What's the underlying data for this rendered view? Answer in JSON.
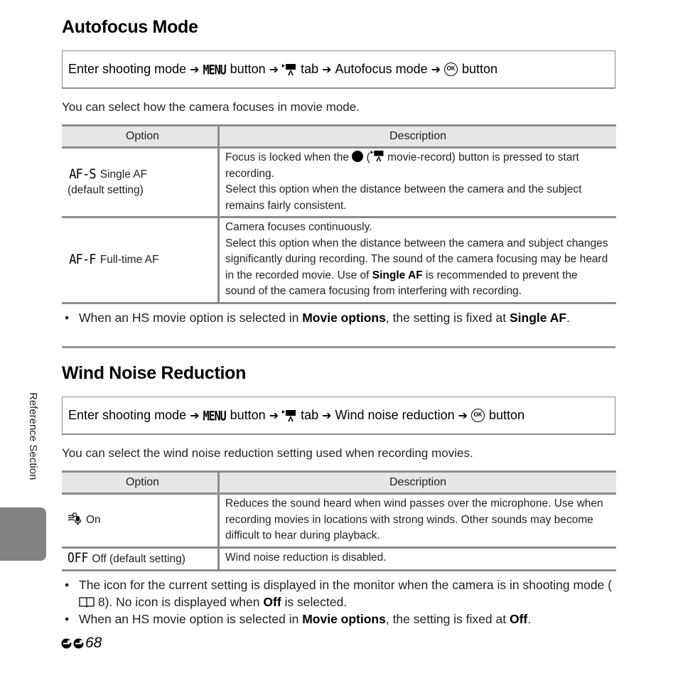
{
  "sections": [
    {
      "title": "Autofocus Mode",
      "path": {
        "step1": "Enter shooting mode",
        "menu_icon": "MENU",
        "step2": "button",
        "movie_tab_icon": "movie-tab-icon",
        "step3": "tab",
        "step4": "Autofocus mode",
        "ok_icon": "OK",
        "step5": "button"
      },
      "intro": "You can select how the camera focuses in movie mode.",
      "table": {
        "headers": [
          "Option",
          "Description"
        ],
        "rows": [
          {
            "icon": "AF-S",
            "label": "Single AF",
            "sublabel": "(default setting)",
            "desc_parts": {
              "a": "Focus is locked when the",
              "b": "(",
              "c": "movie-record) button is pressed to start recording.",
              "d": "Select this option when the distance between the camera and the subject remains fairly consistent."
            }
          },
          {
            "icon": "AF-F",
            "label": "Full-time AF",
            "desc_parts": {
              "a": "Camera focuses continuously.",
              "b": "Select this option when the distance between the camera and subject changes significantly during recording. The sound of the camera focusing may be heard in the recorded movie. Use of",
              "bold": "Single AF",
              "c": "is recommended to prevent the sound of the camera focusing from interfering with recording."
            }
          }
        ]
      },
      "notes": [
        {
          "a": "When an HS movie option is selected in",
          "bold1": "Movie options",
          "b": ", the setting is fixed at",
          "bold2": "Single AF",
          "c": "."
        }
      ]
    },
    {
      "title": "Wind Noise Reduction",
      "path": {
        "step1": "Enter shooting mode",
        "menu_icon": "MENU",
        "step2": "button",
        "movie_tab_icon": "movie-tab-icon",
        "step3": "tab",
        "step4": "Wind noise reduction",
        "ok_icon": "OK",
        "step5": "button"
      },
      "intro": "You can select the wind noise reduction setting used when recording movies.",
      "table": {
        "headers": [
          "Option",
          "Description"
        ],
        "rows": [
          {
            "icon": "wind-noise-icon",
            "label": "On",
            "desc": "Reduces the sound heard when wind passes over the microphone. Use when recording movies in locations with strong winds. Other sounds may become difficult to hear during playback."
          },
          {
            "icon": "OFF",
            "label": "Off (default setting)",
            "desc": "Wind noise reduction is disabled."
          }
        ]
      },
      "notes": [
        {
          "a": "The icon for the current setting is displayed in the monitor when the camera is in shooting mode (",
          "ref": "8",
          "b": "). No icon is displayed when",
          "bold1": "Off",
          "c": "is selected."
        },
        {
          "a": "When an HS movie option is selected in",
          "bold1": "Movie options",
          "b": ", the setting is fixed at",
          "bold2": "Off",
          "c": "."
        }
      ]
    }
  ],
  "sidebar": {
    "label": "Reference Section"
  },
  "footer": {
    "page_number": "68"
  },
  "glyphs": {
    "arrow": "➔",
    "bullet": "•"
  }
}
